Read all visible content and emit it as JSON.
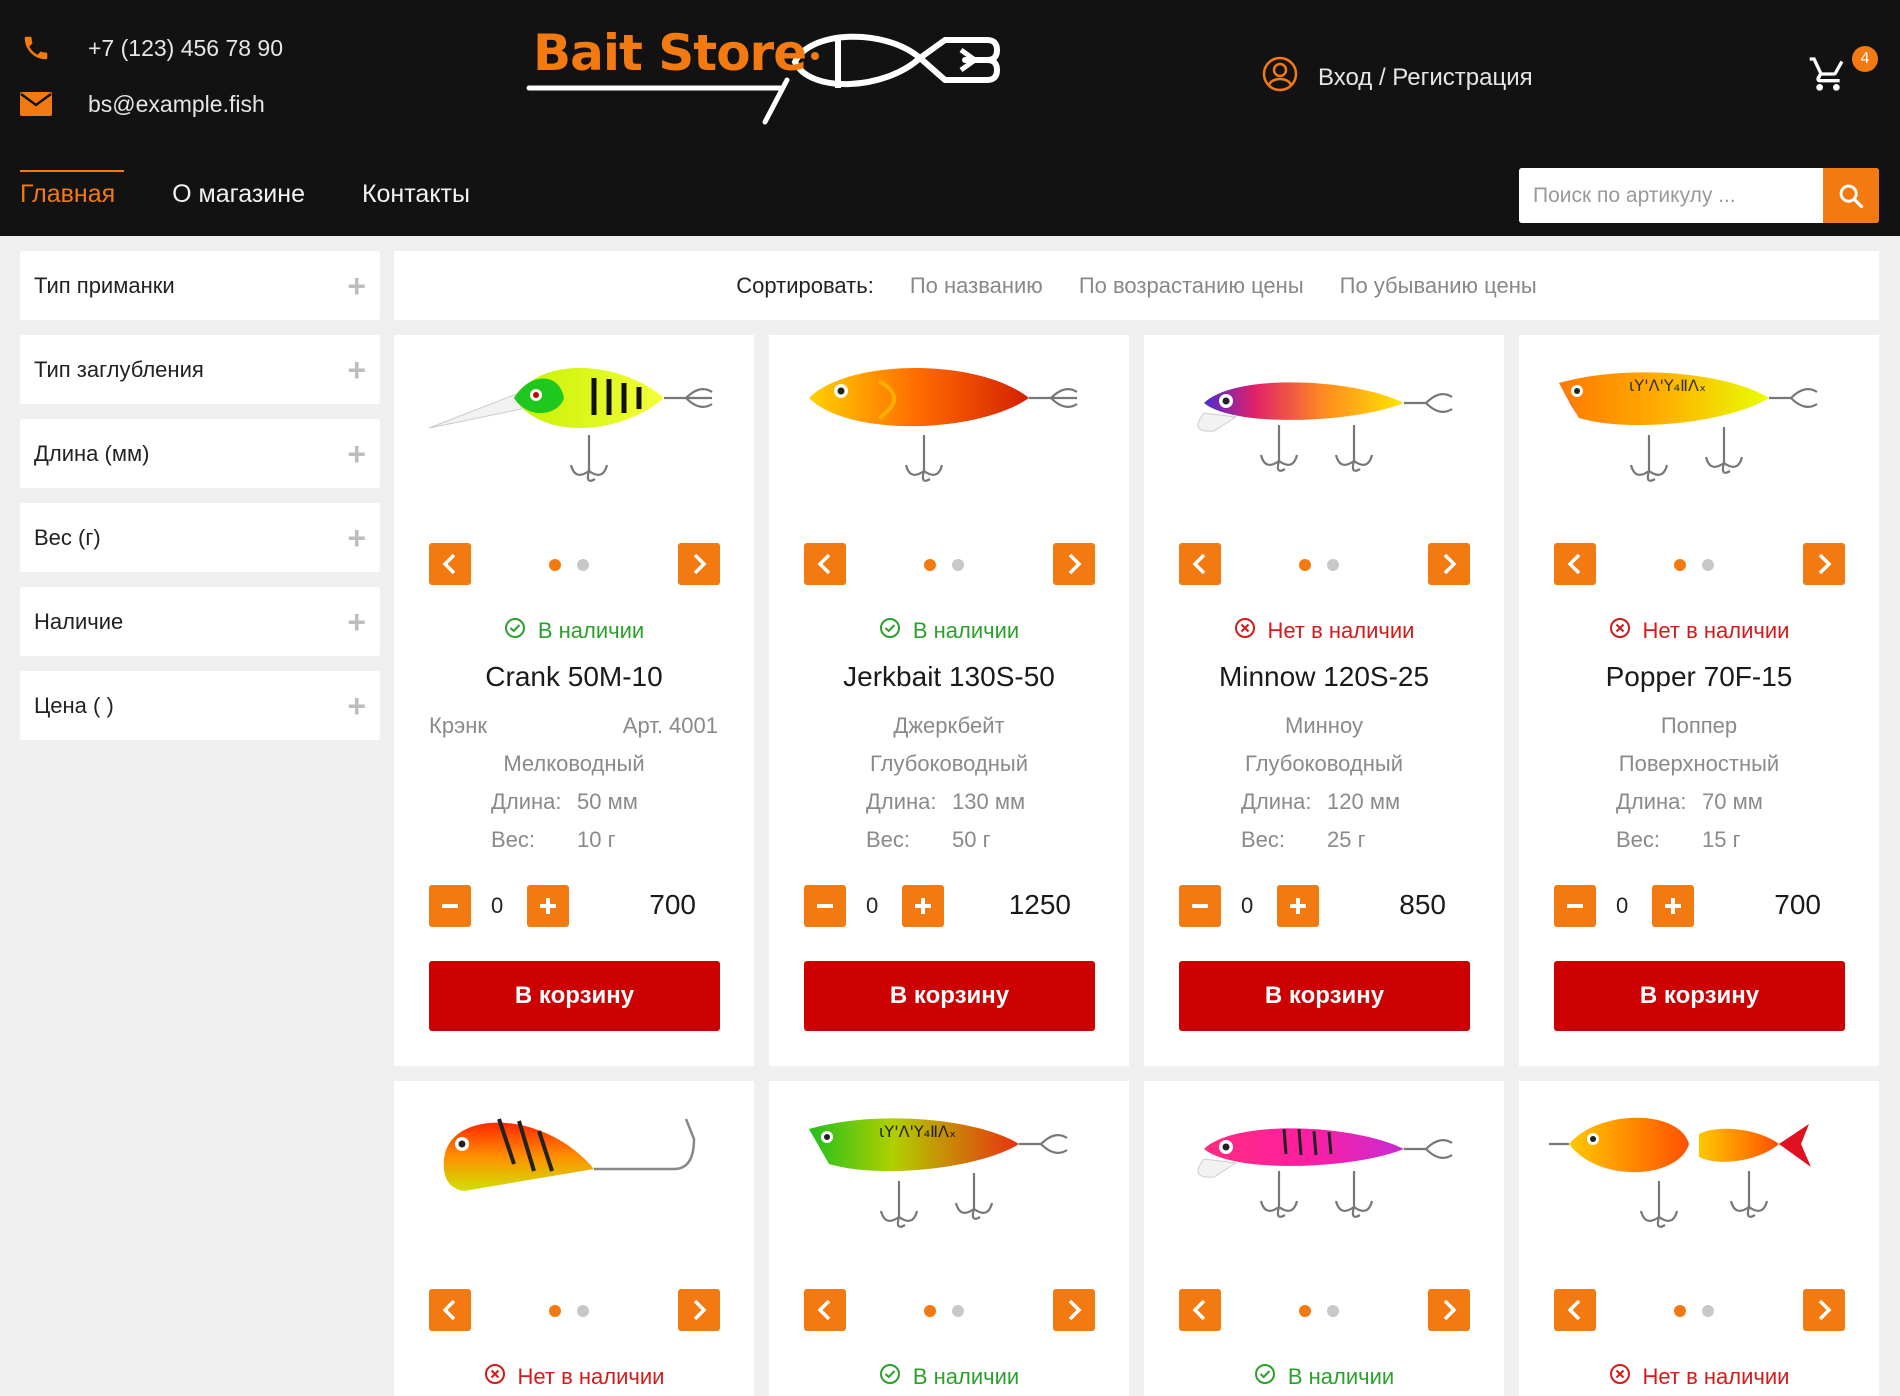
{
  "header": {
    "phone": "+7 (123) 456 78 90",
    "email": "bs@example.fish",
    "logo_text": "Bait Store",
    "login": "Вход / Регистрация",
    "cart_count": "4"
  },
  "nav": {
    "items": [
      "Главная",
      "О магазине",
      "Контакты"
    ],
    "active": "Главная"
  },
  "search": {
    "placeholder": "Поиск по артикулу ..."
  },
  "filters": [
    "Тип приманки",
    "Тип заглубления",
    "Длина (мм)",
    "Вес (г)",
    "Наличие",
    "Цена (  )"
  ],
  "sort": {
    "label": "Сортировать:",
    "options": [
      "По названию",
      "По возрастанию цены",
      "По убыванию цены"
    ]
  },
  "labels": {
    "length": "Длина:",
    "weight": "Вес:",
    "buy": "В корзину"
  },
  "colors": {
    "accent": "#f27a10",
    "buy": "#cc0000",
    "in_stock": "#2ba02b",
    "out_of_stock": "#d41a1a"
  },
  "products": [
    {
      "stock": "В наличии",
      "in_stock": true,
      "name": "Crank 50M-10",
      "type": "Крэнк",
      "article": "Арт. 4001",
      "depth": "Мелководный",
      "length": "50 мм",
      "weight": "10 г",
      "qty": "0",
      "price": "700",
      "lure": "crank"
    },
    {
      "stock": "В наличии",
      "in_stock": true,
      "name": "Jerkbait 130S-50",
      "type": "Джеркбейт",
      "depth": "Глубоководный",
      "length": "130 мм",
      "weight": "50 г",
      "qty": "0",
      "price": "1250",
      "lure": "jerk"
    },
    {
      "stock": "Нет в наличии",
      "in_stock": false,
      "name": "Minnow 120S-25",
      "type": "Минноу",
      "depth": "Глубоководный",
      "length": "120 мм",
      "weight": "25 г",
      "qty": "0",
      "price": "850",
      "lure": "minnow"
    },
    {
      "stock": "Нет в наличии",
      "in_stock": false,
      "name": "Popper 70F-15",
      "type": "Поппер",
      "depth": "Поверхностный",
      "length": "70 мм",
      "weight": "15 г",
      "qty": "0",
      "price": "700",
      "lure": "popper"
    },
    {
      "stock": "Нет в наличии",
      "in_stock": false,
      "lure": "jig"
    },
    {
      "stock": "В наличии",
      "in_stock": true,
      "lure": "popper-green"
    },
    {
      "stock": "В наличии",
      "in_stock": true,
      "lure": "minnow-pink"
    },
    {
      "stock": "Нет в наличии",
      "in_stock": false,
      "lure": "swimbait"
    }
  ]
}
